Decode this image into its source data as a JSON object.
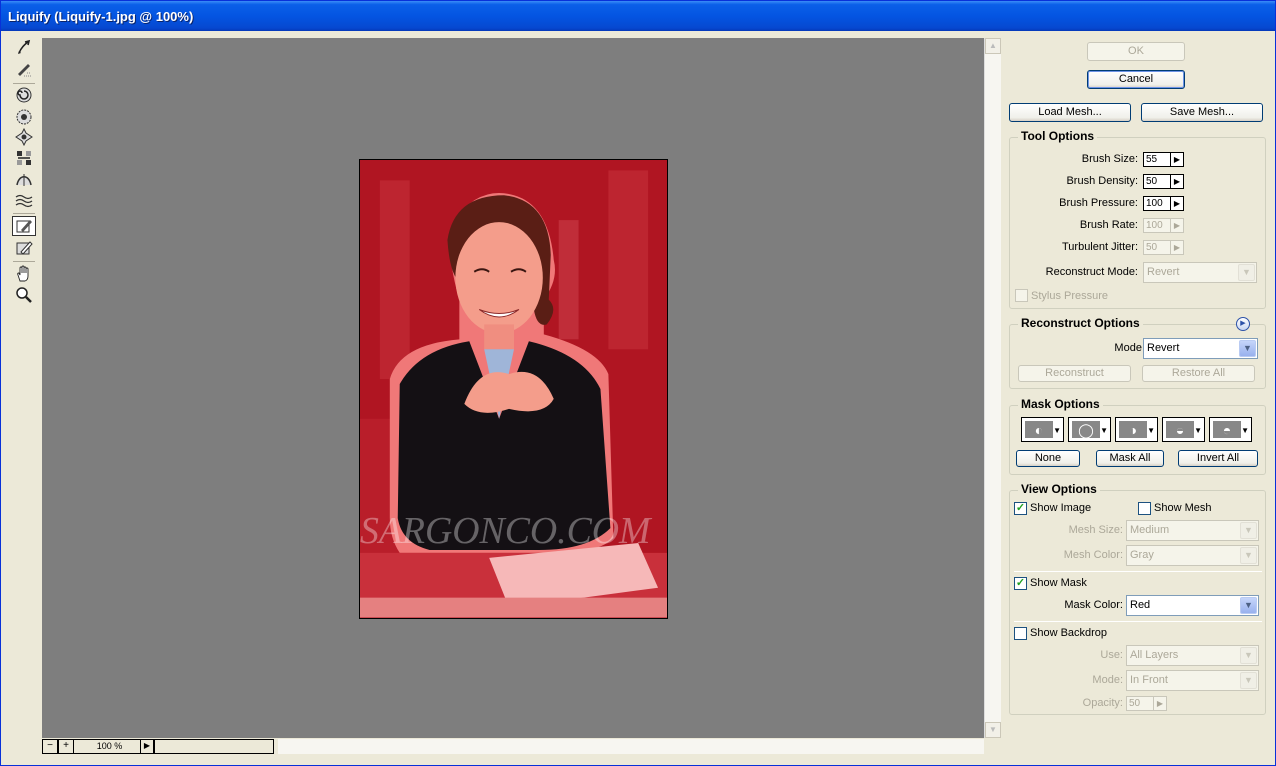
{
  "window": {
    "title": "Liquify (Liquify-1.jpg @ 100%)"
  },
  "toolbox": {
    "tools": [
      {
        "name": "forward-warp-tool-icon"
      },
      {
        "name": "reconstruct-tool-icon"
      },
      {
        "name": "twirl-clockwise-tool-icon"
      },
      {
        "name": "pucker-tool-icon"
      },
      {
        "name": "bloat-tool-icon"
      },
      {
        "name": "push-left-tool-icon"
      },
      {
        "name": "mirror-tool-icon"
      },
      {
        "name": "turbulence-tool-icon"
      },
      {
        "name": "freeze-mask-tool-icon",
        "selected": true
      },
      {
        "name": "thaw-mask-tool-icon"
      },
      {
        "name": "hand-tool-icon"
      },
      {
        "name": "zoom-tool-icon"
      }
    ]
  },
  "canvas": {
    "watermark": "SARGONCO.COM"
  },
  "status": {
    "minus": "−",
    "plus": "+",
    "zoom": "100 %",
    "menu_arrow": "▶"
  },
  "buttons": {
    "ok": "OK",
    "cancel": "Cancel",
    "load_mesh": "Load Mesh...",
    "save_mesh": "Save Mesh..."
  },
  "tool_options": {
    "title": "Tool Options",
    "brush_size_label": "Brush Size:",
    "brush_size": "55",
    "brush_density_label": "Brush Density:",
    "brush_density": "50",
    "brush_pressure_label": "Brush Pressure:",
    "brush_pressure": "100",
    "brush_rate_label": "Brush Rate:",
    "brush_rate": "100",
    "turbulent_jitter_label": "Turbulent Jitter:",
    "turbulent_jitter": "50",
    "reconstruct_mode_label": "Reconstruct Mode:",
    "reconstruct_mode": "Revert",
    "stylus_pressure_label": "Stylus Pressure"
  },
  "reconstruct_options": {
    "title": "Reconstruct Options",
    "mode_label": "Mode:",
    "mode": "Revert",
    "reconstruct": "Reconstruct",
    "restore_all": "Restore All"
  },
  "mask_options": {
    "title": "Mask Options",
    "none": "None",
    "mask_all": "Mask All",
    "invert_all": "Invert All"
  },
  "view_options": {
    "title": "View Options",
    "show_image": "Show Image",
    "show_image_checked": true,
    "show_mesh": "Show Mesh",
    "show_mesh_checked": false,
    "mesh_size_label": "Mesh Size:",
    "mesh_size": "Medium",
    "mesh_color_label": "Mesh Color:",
    "mesh_color": "Gray",
    "show_mask": "Show Mask",
    "show_mask_checked": true,
    "mask_color_label": "Mask Color:",
    "mask_color": "Red",
    "show_backdrop": "Show Backdrop",
    "show_backdrop_checked": false,
    "use_label": "Use:",
    "use": "All Layers",
    "mode_label": "Mode:",
    "mode": "In Front",
    "opacity_label": "Opacity:",
    "opacity": "50"
  },
  "colors": {
    "titlebar": "#0455E2",
    "canvas_bg": "#7E7E7E",
    "mask_red": "#B01522",
    "dialog_bg": "#ECE9D8"
  }
}
